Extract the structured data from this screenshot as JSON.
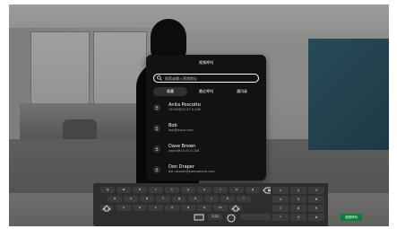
{
  "dialog": {
    "title": "视频呼叫",
    "search_placeholder": "搜索或输入视频地址",
    "tabs": [
      "收藏",
      "最近呼叫",
      "通讯录"
    ]
  },
  "contacts": [
    {
      "name": "Anita Poscotto",
      "address": "74145@10.47.0.108"
    },
    {
      "name": "Bob",
      "address": "bob@disco.com"
    },
    {
      "name": "Dave Brown",
      "address": "yeoro@10.47.0.108"
    },
    {
      "name": "Don Draper",
      "address": "don.draper@somewhere.com"
    }
  ],
  "keyboard": {
    "row1": [
      "q",
      "w",
      "e",
      "r",
      "t",
      "y",
      "u",
      "i",
      "o",
      "p"
    ],
    "row2": [
      "a",
      "s",
      "d",
      "f",
      "g",
      "h",
      "j",
      "k",
      "l"
    ],
    "row3": [
      "z",
      "x",
      "c",
      "v",
      "b",
      "n",
      "m"
    ],
    "numpad": [
      "1",
      "2",
      "3",
      "4",
      "5",
      "6",
      "7",
      "8",
      "9",
      "*",
      "0",
      "#"
    ],
    "special": {
      "lang": "?123",
      "send": "视频呼叫"
    }
  },
  "colors": {
    "dialog": "#121212",
    "send": "#0b7f3a",
    "board": "#2a5566"
  }
}
